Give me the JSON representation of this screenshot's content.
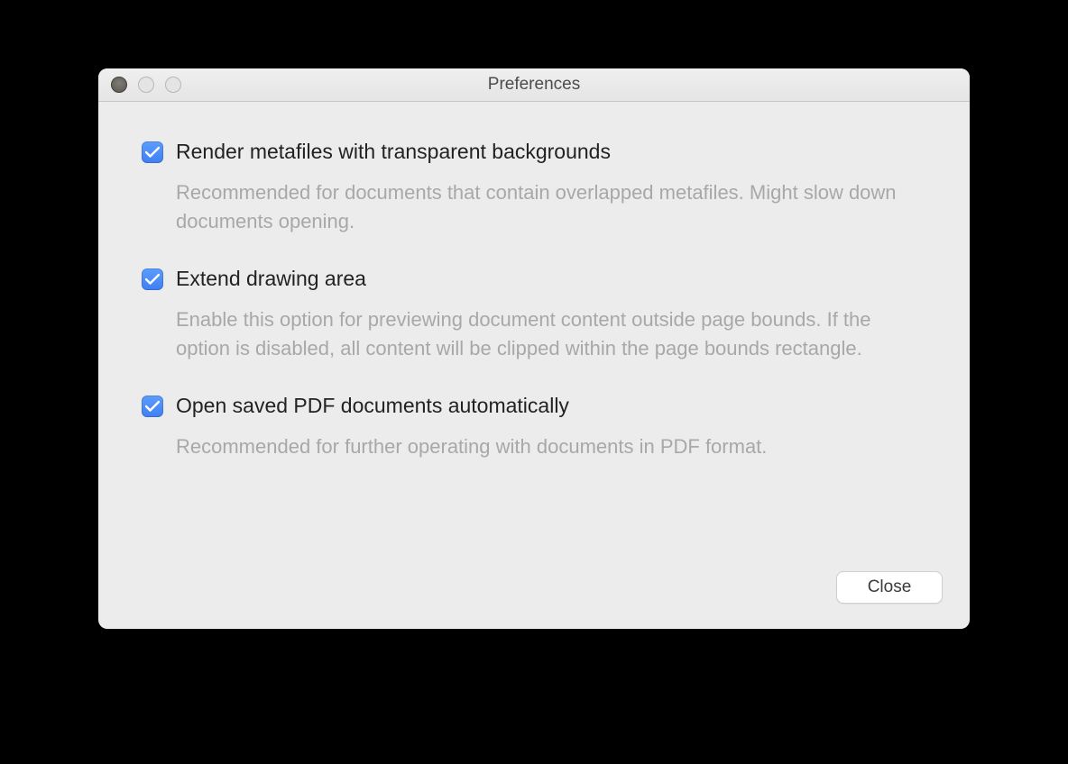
{
  "window": {
    "title": "Preferences"
  },
  "options": [
    {
      "checked": true,
      "label": "Render metafiles with transparent backgrounds",
      "description": "Recommended for documents that contain overlapped metafiles. Might slow down documents opening."
    },
    {
      "checked": true,
      "label": "Extend drawing area",
      "description": "Enable this option for previewing document content outside page bounds. If the option is disabled, all content will be clipped within the page bounds rectangle."
    },
    {
      "checked": true,
      "label": "Open saved PDF documents automatically",
      "description": "Recommended for further operating with documents in PDF format."
    }
  ],
  "buttons": {
    "close": "Close"
  }
}
